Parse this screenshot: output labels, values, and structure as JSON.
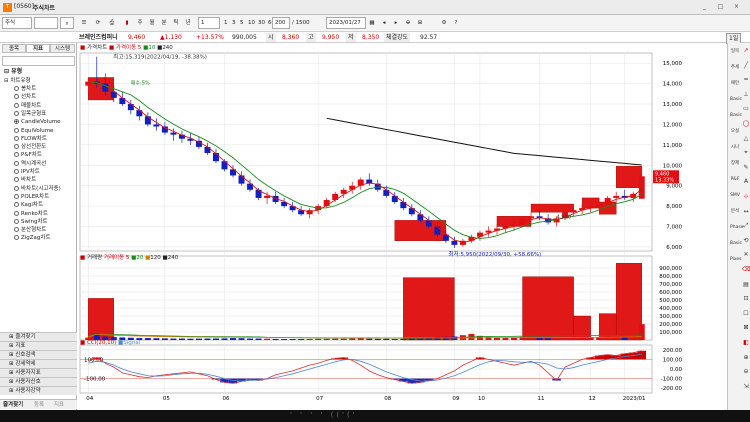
{
  "window": {
    "code": "[0560]",
    "title": "주식차트",
    "minimize": "_",
    "maximize": "□",
    "close": "×"
  },
  "toolbar": {
    "market": "주식",
    "code_placeholder": "",
    "tabs": [
      "주",
      "월",
      "분",
      "틱",
      "년"
    ],
    "interval": "1",
    "intervals": [
      "1",
      "3",
      "5",
      "10",
      "30",
      "60"
    ],
    "count": "200",
    "total": "/ 1500",
    "date": "2023/01/27",
    "fold": "1일"
  },
  "quote": {
    "stock_name": "브레인즈컴퍼니",
    "price": "9,460",
    "change": "▲1,130",
    "change_pct": "+13.57%",
    "volume": "990,005",
    "open_label": "시",
    "open": "8,360",
    "high_label": "고",
    "high": "9,950",
    "low_label": "저",
    "low": "8,350",
    "strength_label": "체결강도",
    "strength": "92.57"
  },
  "left_panel": {
    "tabs": [
      "종목",
      "지표",
      "시스템"
    ],
    "group_title": "유형",
    "section": "차트유형",
    "items": [
      "봉차트",
      "선차트",
      "매물차트",
      "일목균형표",
      "CandleVolume",
      "EquiVolume",
      "FLOW차트",
      "삼선전환도",
      "P&F차트",
      "역시계곡선",
      "IPV차트",
      "바차트",
      "바차트(시고저종)",
      "POLER차트",
      "Kagi차트",
      "Renko차트",
      "Swing차트",
      "분산형차트",
      "ZigZag차트"
    ],
    "selected": "CandleVolume",
    "sections": [
      "즐겨찾기",
      "지표",
      "신호검색",
      "강세약세",
      "사용자지표",
      "사용자신호",
      "사용자강약"
    ],
    "bottom_tabs": [
      "즐겨찾기",
      "등록",
      "지표"
    ]
  },
  "right_bar": {
    "labels": [
      "일목",
      "추세",
      "패턴",
      "Basic",
      "Basic",
      "오실",
      "시나",
      "장제",
      "P&F",
      "SMV",
      "분석",
      "Phase",
      "Basic",
      "Pixes"
    ]
  },
  "bottom_bar": {
    "text": "' ' ' ' (('('"
  },
  "colors": {
    "up": "#e01010",
    "down": "#1020c0",
    "ma5": "#e01010",
    "ma10": "#1a8a1a",
    "ma240": "#111111",
    "cci_up": "#cc0000",
    "cci_down": "#1030c0",
    "bg": "#ffffff",
    "grid": "#e3e3e3"
  },
  "chart_data": [
    {
      "type": "candlestick",
      "legend": [
        "가격차트",
        "가격이동 5",
        "10",
        "240"
      ],
      "annotations": [
        "최고:15,319(2022/04/19, -38.38%)",
        "최저:5,950(2022/09/30, +58.66%)",
        "매수:5%",
        "4,940"
      ],
      "price_tag": "9,460",
      "price_tag_pct": "13.33%",
      "y_ticks": [
        "15,000",
        "14,000",
        "13,000",
        "12,000",
        "11,000",
        "10,000",
        "9,000",
        "8,000",
        "7,000",
        "6,000"
      ],
      "x_ticks": [
        "04",
        "05",
        "06",
        "07",
        "08",
        "09",
        "10",
        "11",
        "12",
        "2023/01"
      ],
      "y_range": [
        5800,
        15500
      ],
      "ohlc": [
        [
          13900,
          14300,
          13600,
          14100
        ],
        [
          14100,
          15319,
          13800,
          14000
        ],
        [
          14000,
          14500,
          13400,
          13600
        ],
        [
          13600,
          13900,
          13100,
          13300
        ],
        [
          13300,
          13600,
          12900,
          13000
        ],
        [
          13000,
          13200,
          12500,
          12700
        ],
        [
          12700,
          12900,
          12200,
          12400
        ],
        [
          12400,
          12600,
          11900,
          12000
        ],
        [
          12000,
          12300,
          11700,
          11900
        ],
        [
          11900,
          12100,
          11500,
          11600
        ],
        [
          11600,
          11800,
          11200,
          11500
        ],
        [
          11500,
          11700,
          11100,
          11300
        ],
        [
          11300,
          11600,
          11000,
          11200
        ],
        [
          11200,
          11400,
          10800,
          10900
        ],
        [
          10900,
          11100,
          10500,
          10600
        ],
        [
          10600,
          10800,
          10100,
          10200
        ],
        [
          10200,
          10300,
          9700,
          9800
        ],
        [
          9800,
          10000,
          9400,
          9500
        ],
        [
          9500,
          9700,
          9000,
          9100
        ],
        [
          9100,
          9300,
          8700,
          8800
        ],
        [
          8800,
          8900,
          8300,
          8400
        ],
        [
          8400,
          8700,
          8100,
          8500
        ],
        [
          8500,
          8700,
          8100,
          8200
        ],
        [
          8200,
          8400,
          7900,
          8000
        ],
        [
          8000,
          8200,
          7700,
          7800
        ],
        [
          7800,
          8000,
          7500,
          7600
        ],
        [
          7600,
          7900,
          7400,
          7800
        ],
        [
          7800,
          8100,
          7600,
          8000
        ],
        [
          8000,
          8400,
          7900,
          8300
        ],
        [
          8300,
          8700,
          8200,
          8600
        ],
        [
          8600,
          8900,
          8400,
          8800
        ],
        [
          8800,
          9200,
          8600,
          9000
        ],
        [
          9000,
          9400,
          8800,
          9300
        ],
        [
          9300,
          9600,
          9000,
          9100
        ],
        [
          9100,
          9300,
          8700,
          8800
        ],
        [
          8800,
          9000,
          8400,
          8500
        ],
        [
          8500,
          8700,
          8100,
          8200
        ],
        [
          8200,
          8400,
          7800,
          7900
        ],
        [
          7900,
          8100,
          7500,
          7600
        ],
        [
          7600,
          7800,
          7200,
          7300
        ],
        [
          7300,
          7500,
          6900,
          7000
        ],
        [
          7000,
          7200,
          6500,
          6600
        ],
        [
          6600,
          6800,
          6200,
          6300
        ],
        [
          6300,
          6500,
          5950,
          6100
        ],
        [
          6100,
          6400,
          6000,
          6300
        ],
        [
          6300,
          6600,
          6200,
          6500
        ],
        [
          6500,
          6800,
          6300,
          6700
        ],
        [
          6700,
          7000,
          6500,
          6800
        ],
        [
          6800,
          7100,
          6600,
          6900
        ],
        [
          6900,
          7200,
          6700,
          7000
        ],
        [
          7000,
          7300,
          6800,
          7100
        ],
        [
          7100,
          7500,
          7000,
          7400
        ],
        [
          7400,
          7700,
          7200,
          7500
        ],
        [
          7500,
          7800,
          7300,
          7400
        ],
        [
          7400,
          7600,
          7100,
          7200
        ],
        [
          7200,
          7500,
          7000,
          7400
        ],
        [
          7400,
          7800,
          7300,
          7700
        ],
        [
          7700,
          8000,
          7500,
          7800
        ],
        [
          7800,
          8100,
          7600,
          7900
        ],
        [
          7900,
          8200,
          7700,
          8000
        ],
        [
          8000,
          8300,
          7800,
          8100
        ],
        [
          8100,
          8500,
          8000,
          8400
        ],
        [
          8400,
          8700,
          8200,
          8500
        ],
        [
          8500,
          8800,
          8300,
          8400
        ],
        [
          8400,
          8700,
          8200,
          8600
        ],
        [
          8360,
          9950,
          8350,
          9460
        ]
      ],
      "volume_legend": [
        "거래량",
        "거래이동 5",
        "20",
        "120",
        "240"
      ],
      "volume_y_ticks": [
        "900,000",
        "800,000",
        "700,000",
        "600,000",
        "500,000",
        "400,000",
        "300,000",
        "200,000",
        "100,000"
      ],
      "volume": [
        150,
        420,
        210,
        180,
        160,
        140,
        120,
        120,
        110,
        100,
        90,
        90,
        80,
        85,
        90,
        95,
        100,
        120,
        110,
        90,
        90,
        80,
        70,
        60,
        60,
        60,
        65,
        70,
        75,
        80,
        80,
        90,
        100,
        80,
        70,
        70,
        60,
        70,
        90,
        110,
        160,
        180,
        200,
        220,
        300,
        380,
        260,
        180,
        160,
        150,
        160,
        200,
        160,
        120,
        110,
        130,
        200,
        160,
        140,
        150,
        170,
        280,
        240,
        200,
        210,
        990
      ]
    },
    {
      "type": "line",
      "legend": [
        "CCI(20,10)",
        "Signal"
      ],
      "y_ticks": [
        "200.00",
        "100.00",
        "0.00",
        "-100.00",
        "-200.00"
      ],
      "left_labels": [
        "100.00",
        "-100.00"
      ],
      "y_range": [
        -250,
        250
      ],
      "cci": [
        80,
        120,
        60,
        20,
        -40,
        -60,
        -80,
        -90,
        -70,
        -60,
        -50,
        -40,
        -30,
        -50,
        -70,
        -110,
        -140,
        -150,
        -130,
        -110,
        -120,
        -100,
        -60,
        -40,
        -20,
        10,
        40,
        60,
        90,
        110,
        120,
        90,
        40,
        -20,
        -60,
        -90,
        -110,
        -130,
        -150,
        -140,
        -120,
        -100,
        -60,
        -20,
        40,
        80,
        120,
        100,
        80,
        60,
        40,
        60,
        80,
        40,
        -40,
        -120,
        20,
        60,
        100,
        120,
        140,
        150,
        140,
        160,
        170,
        190
      ],
      "signal": [
        60,
        80,
        70,
        40,
        0,
        -30,
        -50,
        -70,
        -75,
        -70,
        -60,
        -50,
        -45,
        -45,
        -55,
        -75,
        -100,
        -120,
        -125,
        -120,
        -115,
        -105,
        -90,
        -70,
        -50,
        -25,
        0,
        25,
        50,
        75,
        95,
        100,
        80,
        50,
        10,
        -30,
        -60,
        -90,
        -110,
        -125,
        -125,
        -115,
        -95,
        -70,
        -35,
        5,
        45,
        75,
        90,
        85,
        75,
        70,
        70,
        65,
        50,
        10,
        0,
        15,
        40,
        60,
        80,
        100,
        115,
        130,
        140,
        155
      ]
    }
  ]
}
